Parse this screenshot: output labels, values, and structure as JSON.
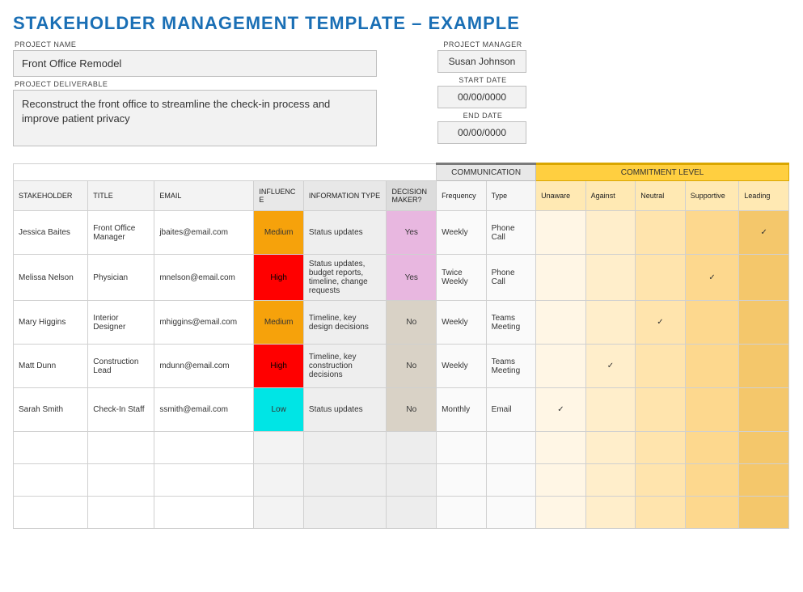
{
  "title": "STAKEHOLDER MANAGEMENT TEMPLATE – EXAMPLE",
  "labels": {
    "project_name": "PROJECT NAME",
    "project_deliverable": "PROJECT DELIVERABLE",
    "project_manager": "PROJECT MANAGER",
    "start_date": "START DATE",
    "end_date": "END DATE"
  },
  "fields": {
    "project_name": "Front Office Remodel",
    "project_deliverable": "Reconstruct the front office to streamline the check-in process and improve patient privacy",
    "project_manager": "Susan Johnson",
    "start_date": "00/00/0000",
    "end_date": "00/00/0000"
  },
  "section_headers": {
    "communication": "COMMUNICATION",
    "commitment": "COMMITMENT LEVEL"
  },
  "columns": {
    "stakeholder": "STAKEHOLDER",
    "title": "TITLE",
    "email": "EMAIL",
    "influence": "INFLUENCE",
    "info_type": "INFORMATION TYPE",
    "decision": "DECISION MAKER?",
    "frequency": "Frequency",
    "type": "Type",
    "unaware": "Unaware",
    "against": "Against",
    "neutral": "Neutral",
    "supportive": "Supportive",
    "leading": "Leading"
  },
  "commitment_levels": [
    "unaware",
    "against",
    "neutral",
    "supportive",
    "leading"
  ],
  "checkmark": "✓",
  "rows": [
    {
      "stakeholder": "Jessica Baites",
      "title": "Front Office Manager",
      "email": "jbaites@email.com",
      "influence": "Medium",
      "info": "Status updates",
      "decision": "Yes",
      "frequency": "Weekly",
      "type": "Phone Call",
      "commitment": "leading"
    },
    {
      "stakeholder": "Melissa Nelson",
      "title": "Physician",
      "email": "mnelson@email.com",
      "influence": "High",
      "info": "Status updates, budget reports, timeline, change requests",
      "decision": "Yes",
      "frequency": "Twice Weekly",
      "type": "Phone Call",
      "commitment": "supportive"
    },
    {
      "stakeholder": "Mary Higgins",
      "title": "Interior Designer",
      "email": "mhiggins@email.com",
      "influence": "Medium",
      "info": "Timeline, key design decisions",
      "decision": "No",
      "frequency": "Weekly",
      "type": "Teams Meeting",
      "commitment": "neutral"
    },
    {
      "stakeholder": "Matt Dunn",
      "title": "Construction Lead",
      "email": "mdunn@email.com",
      "influence": "High",
      "info": "Timeline, key construction decisions",
      "decision": "No",
      "frequency": "Weekly",
      "type": "Teams Meeting",
      "commitment": "against"
    },
    {
      "stakeholder": "Sarah Smith",
      "title": "Check-In Staff",
      "email": "ssmith@email.com",
      "influence": "Low",
      "info": "Status updates",
      "decision": "No",
      "frequency": "Monthly",
      "type": "Email",
      "commitment": "unaware"
    }
  ],
  "empty_rows": 3
}
